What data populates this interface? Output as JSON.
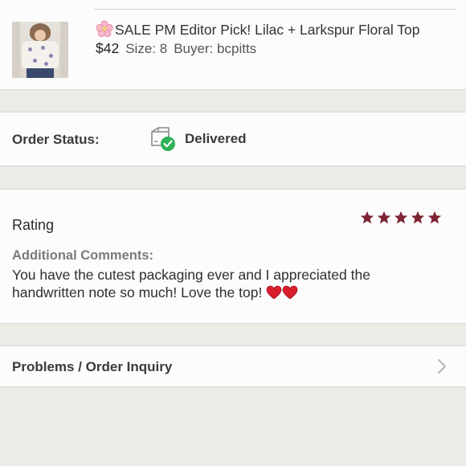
{
  "item": {
    "title_icon": "cherry-blossom-icon",
    "title": "SALE PM Editor Pick! Lilac + Larkspur Floral Top",
    "price": "$42",
    "size": "Size: 8",
    "buyer": "Buyer: bcpitts"
  },
  "status": {
    "label": "Order Status:",
    "icon": "package-delivered-icon",
    "value": "Delivered"
  },
  "rating": {
    "label": "Rating",
    "stars": 5,
    "max_stars": 5,
    "star_color": "#7d2434",
    "comments_label": "Additional Comments:",
    "comment": "You have the cutest packaging ever and I appreciated the handwritten note so much! Love the top!"
  },
  "problems": {
    "label": "Problems / Order Inquiry"
  },
  "colors": {
    "background": "#ecebe6",
    "card": "#fdfcfc",
    "accent": "#7d2434",
    "success": "#2fb157"
  }
}
